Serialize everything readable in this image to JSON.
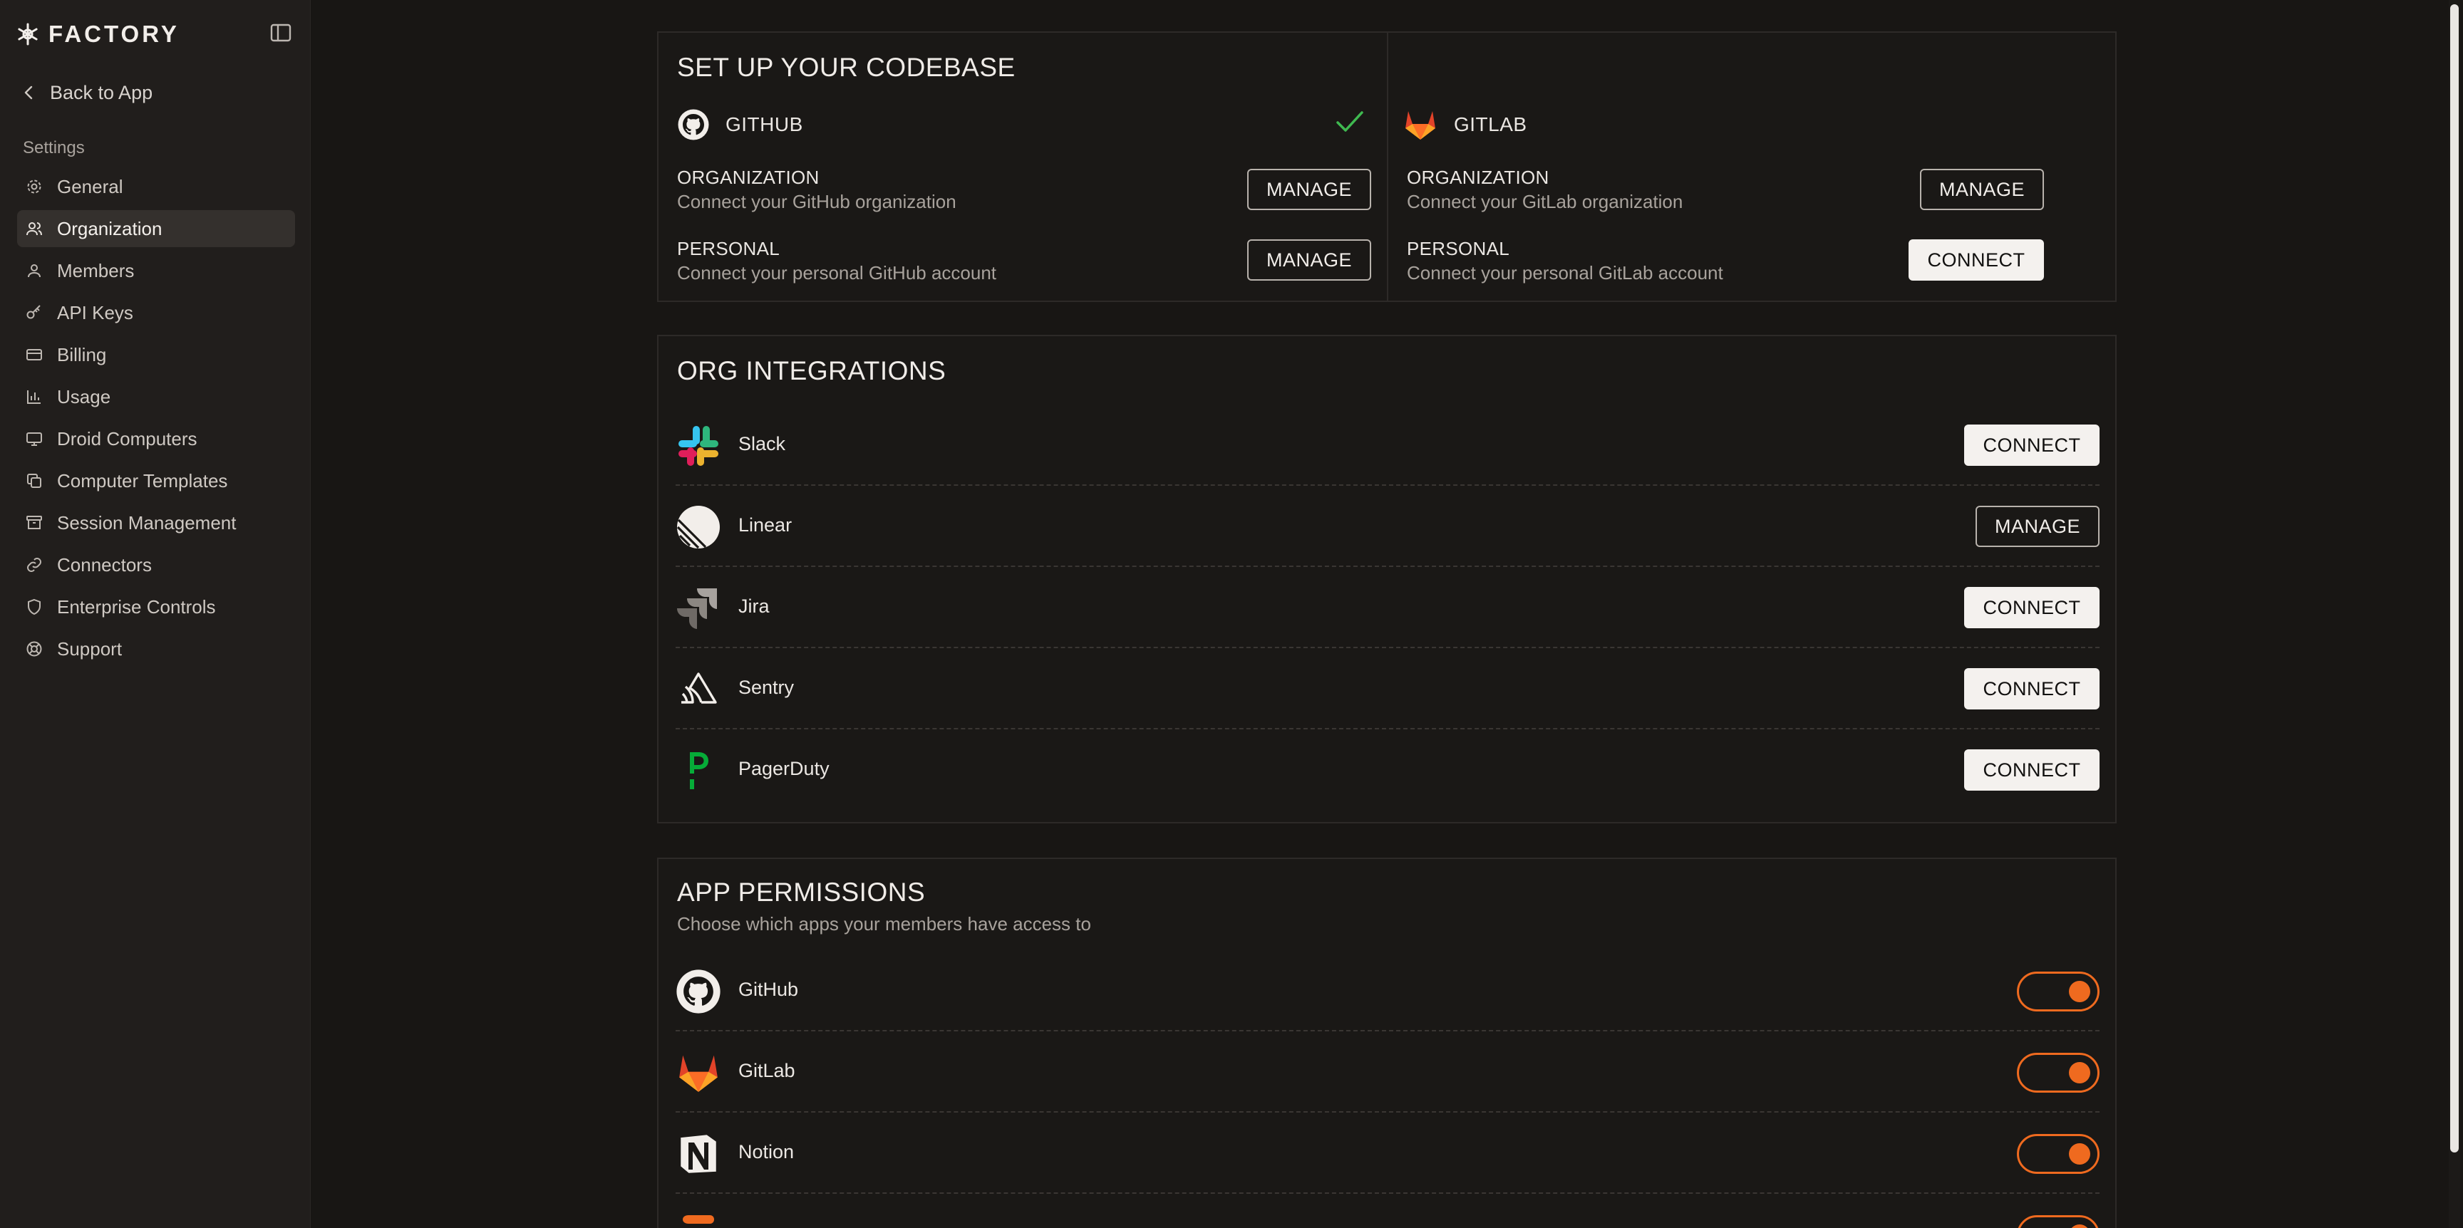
{
  "sidebar": {
    "brand": "FACTORY",
    "back_label": "Back to App",
    "section_label": "Settings",
    "items": [
      {
        "label": "General",
        "icon": "gear-icon"
      },
      {
        "label": "Organization",
        "icon": "users-icon",
        "active": true
      },
      {
        "label": "Members",
        "icon": "user-icon"
      },
      {
        "label": "API Keys",
        "icon": "key-icon"
      },
      {
        "label": "Billing",
        "icon": "credit-card-icon"
      },
      {
        "label": "Usage",
        "icon": "bar-chart-icon"
      },
      {
        "label": "Droid Computers",
        "icon": "monitor-icon"
      },
      {
        "label": "Computer Templates",
        "icon": "copy-icon"
      },
      {
        "label": "Session Management",
        "icon": "archive-icon"
      },
      {
        "label": "Connectors",
        "icon": "link-icon"
      },
      {
        "label": "Enterprise Controls",
        "icon": "shield-icon"
      },
      {
        "label": "Support",
        "icon": "lifebuoy-icon"
      }
    ]
  },
  "codebase": {
    "title": "SET UP YOUR CODEBASE",
    "github": {
      "name": "GITHUB",
      "connected": true,
      "org_label": "ORGANIZATION",
      "org_sub": "Connect your GitHub organization",
      "org_button": "MANAGE",
      "personal_label": "PERSONAL",
      "personal_sub": "Connect your personal GitHub account",
      "personal_button": "MANAGE"
    },
    "gitlab": {
      "name": "GITLAB",
      "org_label": "ORGANIZATION",
      "org_sub": "Connect your GitLab organization",
      "org_button": "MANAGE",
      "personal_label": "PERSONAL",
      "personal_sub": "Connect your personal GitLab account",
      "personal_button": "CONNECT"
    }
  },
  "integrations": {
    "title": "ORG INTEGRATIONS",
    "items": [
      {
        "name": "Slack",
        "button": "CONNECT",
        "icon": "slack-icon"
      },
      {
        "name": "Linear",
        "button": "MANAGE",
        "icon": "linear-icon"
      },
      {
        "name": "Jira",
        "button": "CONNECT",
        "icon": "jira-icon"
      },
      {
        "name": "Sentry",
        "button": "CONNECT",
        "icon": "sentry-icon"
      },
      {
        "name": "PagerDuty",
        "button": "CONNECT",
        "icon": "pagerduty-icon"
      }
    ]
  },
  "permissions": {
    "title": "APP PERMISSIONS",
    "subtitle": "Choose which apps your members have access to",
    "items": [
      {
        "name": "GitHub",
        "enabled": true,
        "icon": "github-icon"
      },
      {
        "name": "GitLab",
        "enabled": true,
        "icon": "gitlab-icon"
      },
      {
        "name": "Notion",
        "enabled": true,
        "icon": "notion-icon"
      }
    ]
  },
  "colors": {
    "accent": "#ef6a1f",
    "background": "#181614",
    "sidebar": "#211e1c",
    "success": "#3fb950"
  }
}
